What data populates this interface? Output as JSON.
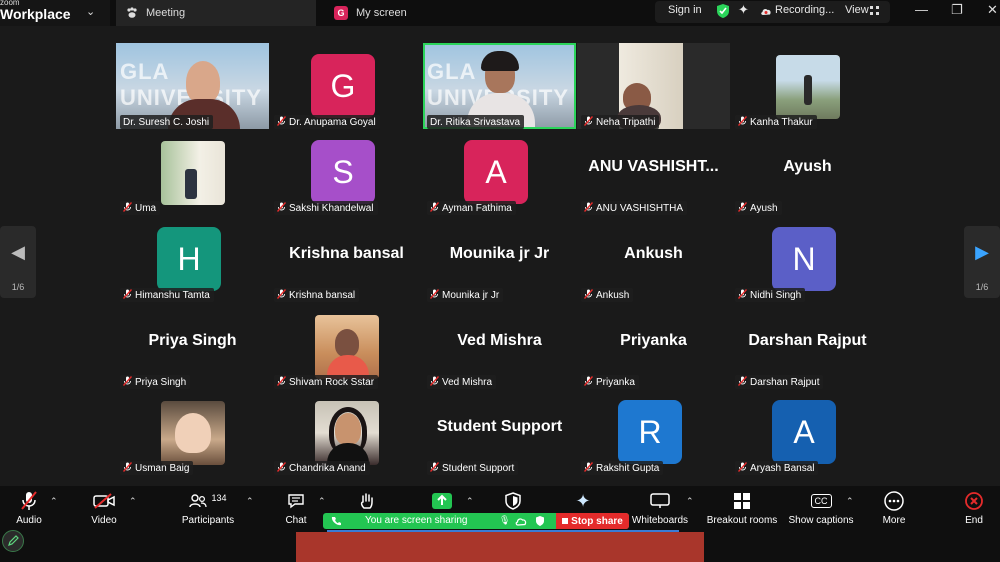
{
  "titlebar": {
    "brand_small": "zoom",
    "brand": "Workplace",
    "tab_meeting": "Meeting",
    "tab_screen_badge": "G",
    "tab_screen": "My screen",
    "sign_in": "Sign in",
    "recording": "Recording...",
    "view": "View"
  },
  "participants": [
    {
      "name": "Dr. Suresh C. Joshi",
      "kind": "video",
      "muted": false
    },
    {
      "name": "Dr. Anupama Goyal",
      "kind": "avatar",
      "letter": "G",
      "color": "#d8245b",
      "muted": true
    },
    {
      "name": "Dr. Ritika Srivastava",
      "kind": "video",
      "active": true,
      "muted": false
    },
    {
      "name": "Neha Tripathi",
      "kind": "video",
      "muted": true
    },
    {
      "name": "Kanha Thakur",
      "kind": "photo",
      "muted": true
    },
    {
      "name": "Uma",
      "kind": "photo",
      "muted": true
    },
    {
      "name": "Sakshi Khandelwal",
      "kind": "avatar",
      "letter": "S",
      "color": "#a64fc9",
      "muted": true
    },
    {
      "name": "Ayman Fathima",
      "kind": "avatar",
      "letter": "A",
      "color": "#d8245b",
      "muted": true
    },
    {
      "name": "ANU VASHISHTHA",
      "kind": "text",
      "display": "ANU  VASHISHT...",
      "muted": true
    },
    {
      "name": "Ayush",
      "kind": "text",
      "display": "Ayush",
      "muted": true
    },
    {
      "name": "Himanshu Tamta",
      "kind": "avatar",
      "letter": "H",
      "color": "#14967c",
      "muted": true
    },
    {
      "name": "Krishna bansal",
      "kind": "text",
      "display": "Krishna bansal",
      "muted": true
    },
    {
      "name": "Mounika jr Jr",
      "kind": "text",
      "display": "Mounika jr Jr",
      "muted": true
    },
    {
      "name": "Ankush",
      "kind": "text",
      "display": "Ankush",
      "muted": true
    },
    {
      "name": "Nidhi Singh",
      "kind": "avatar",
      "letter": "N",
      "color": "#5b5fc7",
      "muted": true
    },
    {
      "name": "Priya Singh",
      "kind": "text",
      "display": "Priya Singh",
      "muted": true
    },
    {
      "name": "Shivam Rock Sstar",
      "kind": "photo",
      "muted": true
    },
    {
      "name": "Ved Mishra",
      "kind": "text",
      "display": "Ved Mishra",
      "muted": true
    },
    {
      "name": "Priyanka",
      "kind": "text",
      "display": "Priyanka",
      "muted": true
    },
    {
      "name": "Darshan Rajput",
      "kind": "text",
      "display": "Darshan Rajput",
      "muted": true
    },
    {
      "name": "Usman Baig",
      "kind": "photo",
      "muted": true
    },
    {
      "name": "Chandrika Anand",
      "kind": "photo",
      "muted": true
    },
    {
      "name": "Student Support",
      "kind": "text",
      "display": "Student Support",
      "muted": true
    },
    {
      "name": "Rakshit Gupta",
      "kind": "avatar",
      "letter": "R",
      "color": "#1e78d0",
      "muted": true
    },
    {
      "name": "Aryash Bansal",
      "kind": "avatar",
      "letter": "A",
      "color": "#1560b0",
      "muted": true
    }
  ],
  "nav": {
    "page_left": "1/6",
    "page_right": "1/6"
  },
  "toolbar": {
    "audio": "Audio",
    "video": "Video",
    "participants": "Participants",
    "participants_count": "134",
    "chat": "Chat",
    "whiteboards": "Whiteboards",
    "breakout": "Breakout rooms",
    "captions": "Show captions",
    "captions_badge": "CC",
    "more": "More",
    "end": "End",
    "sharing": "You are screen sharing",
    "stop_share": "Stop share"
  }
}
